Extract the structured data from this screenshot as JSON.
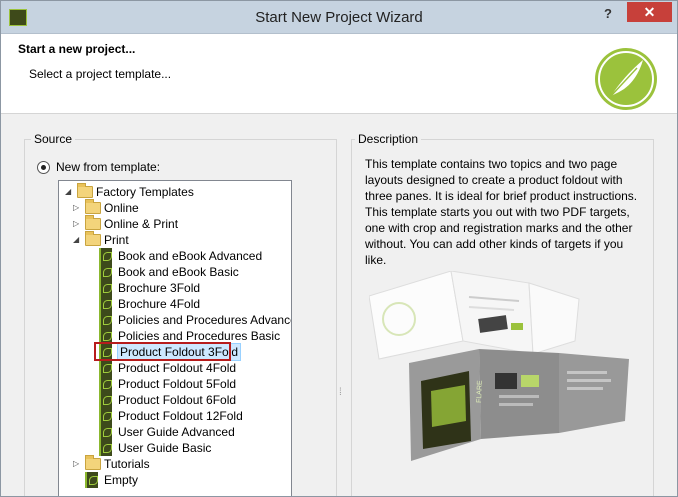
{
  "window": {
    "title": "Start New Project Wizard",
    "help_label": "?",
    "close_label": "✕"
  },
  "header": {
    "title": "Start a new project...",
    "subtitle": "Select a project template..."
  },
  "source": {
    "legend": "Source",
    "radio_label": "New from template:",
    "tree": [
      {
        "label": "Factory Templates",
        "icon": "folder-icon",
        "expander": "◢",
        "level": 0
      },
      {
        "label": "Online",
        "icon": "folder-icon",
        "expander": "▷",
        "level": 1
      },
      {
        "label": "Online & Print",
        "icon": "folder-icon",
        "expander": "▷",
        "level": 1
      },
      {
        "label": "Print",
        "icon": "folder-icon",
        "expander": "◢",
        "level": 1
      },
      {
        "label": "Book and eBook Advanced",
        "icon": "template-icon",
        "level": 2
      },
      {
        "label": "Book and eBook Basic",
        "icon": "template-icon",
        "level": 2
      },
      {
        "label": "Brochure 3Fold",
        "icon": "template-icon",
        "level": 2
      },
      {
        "label": "Brochure 4Fold",
        "icon": "template-icon",
        "level": 2
      },
      {
        "label": "Policies and Procedures Advanced",
        "icon": "template-icon",
        "level": 2
      },
      {
        "label": "Policies and Procedures Basic",
        "icon": "template-icon",
        "level": 2
      },
      {
        "label": "Product Foldout 3Fold",
        "icon": "template-icon",
        "level": 2,
        "selected": true
      },
      {
        "label": "Product Foldout 4Fold",
        "icon": "template-icon",
        "level": 2
      },
      {
        "label": "Product Foldout 5Fold",
        "icon": "template-icon",
        "level": 2
      },
      {
        "label": "Product Foldout 6Fold",
        "icon": "template-icon",
        "level": 2
      },
      {
        "label": "Product Foldout 12Fold",
        "icon": "template-icon",
        "level": 2
      },
      {
        "label": "User Guide Advanced",
        "icon": "template-icon",
        "level": 2
      },
      {
        "label": "User Guide Basic",
        "icon": "template-icon",
        "level": 2
      },
      {
        "label": "Tutorials",
        "icon": "folder-icon",
        "expander": "▷",
        "level": 1
      },
      {
        "label": "Empty",
        "icon": "template-icon",
        "level": 1
      }
    ]
  },
  "description": {
    "legend": "Description",
    "text": "This template contains two topics and two page layouts designed to create a product foldout with three panes.  It is ideal for brief product instructions. This template starts you out with two PDF targets, one with crop and registration marks and the other without.  You can add other kinds of targets if you like.",
    "preview_brand": "FLARE"
  },
  "colors": {
    "accent": "#9bc23c",
    "selection": "#cde8ff",
    "highlight": "#b71c1c"
  }
}
